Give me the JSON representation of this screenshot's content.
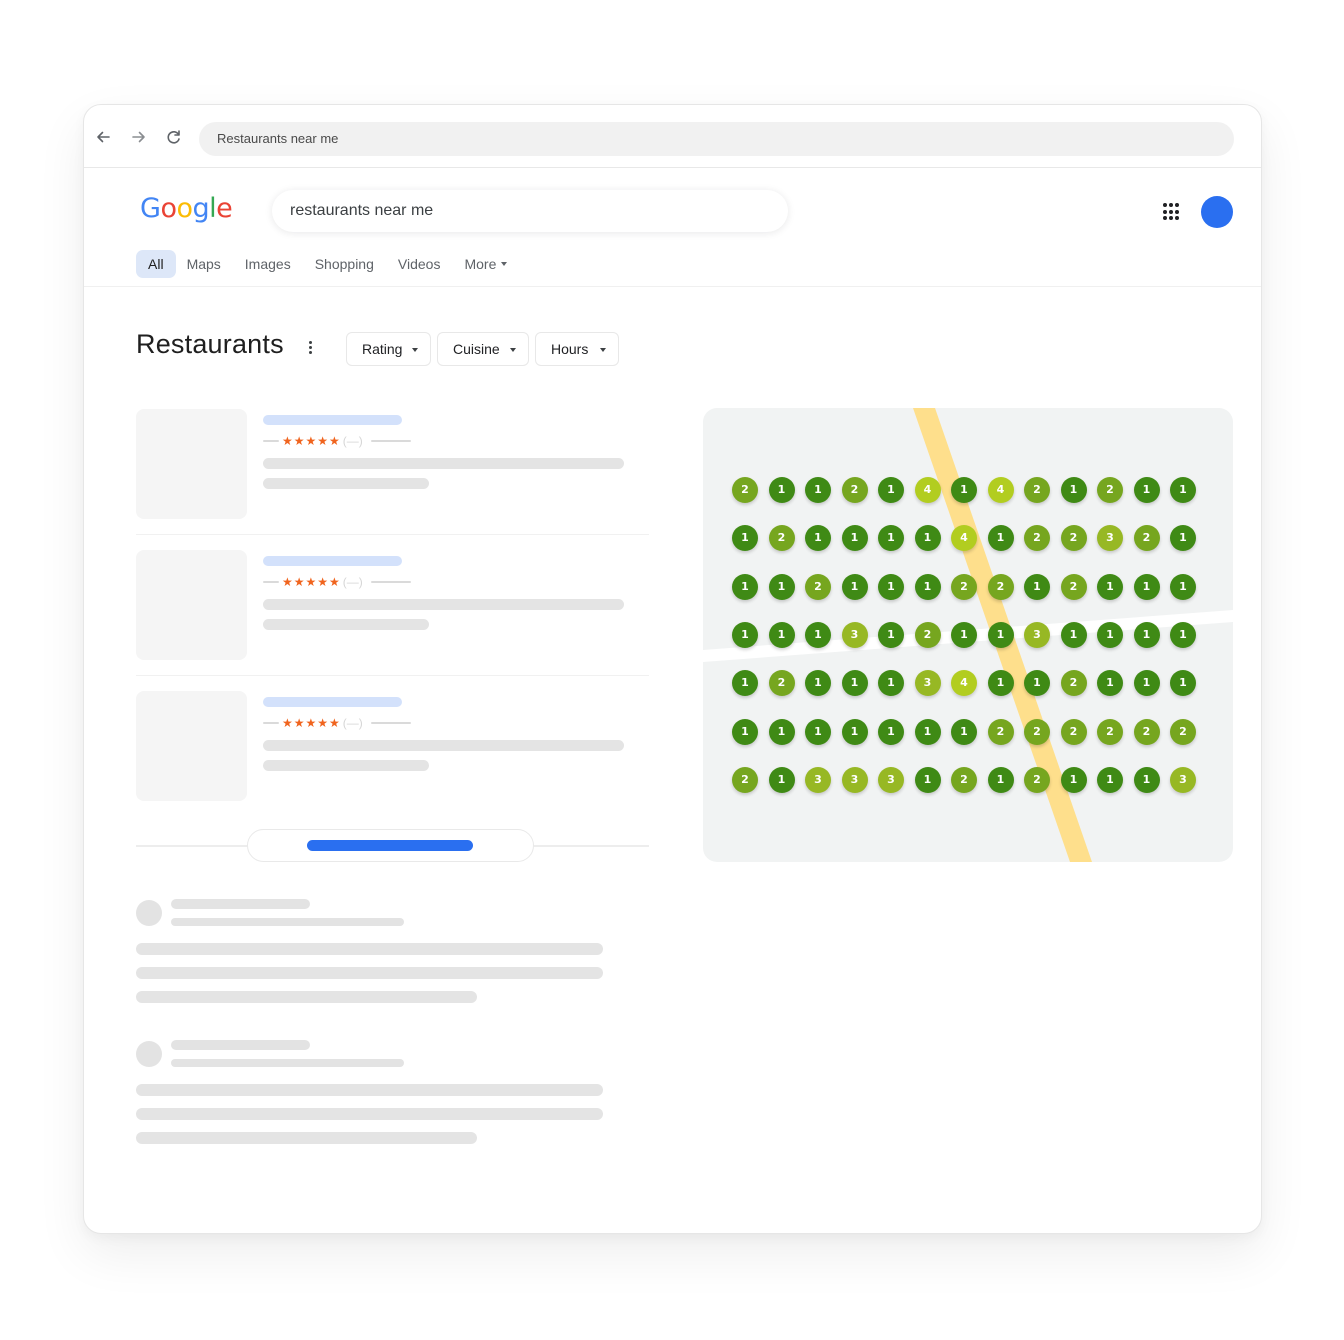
{
  "browser": {
    "address_bar": "Restaurants near me",
    "back_icon": "arrow-left-icon",
    "forward_icon": "arrow-right-icon",
    "reload_icon": "reload-icon"
  },
  "header": {
    "logo": {
      "letters": [
        "G",
        "o",
        "o",
        "g",
        "l",
        "e"
      ],
      "colors": [
        "#4285f4",
        "#ea4335",
        "#fbbc05",
        "#4285f4",
        "#34a853",
        "#ea4335"
      ]
    },
    "search_query": "restaurants near me",
    "apps_icon": "apps-grid-icon",
    "avatar_color": "#2a6ff0"
  },
  "tabs": [
    {
      "label": "All",
      "active": true
    },
    {
      "label": "Maps",
      "active": false
    },
    {
      "label": "Images",
      "active": false
    },
    {
      "label": "Shopping",
      "active": false
    },
    {
      "label": "Videos",
      "active": false
    },
    {
      "label": "More",
      "active": false,
      "dropdown": true
    }
  ],
  "section": {
    "title": "Restaurants",
    "filters": [
      {
        "label": "Rating"
      },
      {
        "label": "Cuisine"
      },
      {
        "label": "Hours"
      }
    ]
  },
  "results": [
    {
      "stars": "★★★★★",
      "reviews": "(—)"
    },
    {
      "stars": "★★★★★",
      "reviews": "(—)"
    },
    {
      "stars": "★★★★★",
      "reviews": "(—)"
    }
  ],
  "colors": {
    "accent": "#2a6ff0",
    "star": "#f0641e",
    "road_main": "#fedf8c",
    "rank_1": "#3f8a15",
    "rank_2": "#76a61f",
    "rank_3": "#97b824",
    "rank_4": "#b2cd20"
  },
  "map": {
    "rank_grid": [
      [
        2,
        1,
        1,
        2,
        1,
        4,
        1,
        4,
        2,
        1,
        2,
        1,
        1
      ],
      [
        1,
        2,
        1,
        1,
        1,
        1,
        4,
        1,
        2,
        2,
        3,
        2,
        1
      ],
      [
        1,
        1,
        2,
        1,
        1,
        1,
        2,
        2,
        1,
        2,
        1,
        1,
        1
      ],
      [
        1,
        1,
        1,
        3,
        1,
        2,
        1,
        1,
        3,
        1,
        1,
        1,
        1
      ],
      [
        1,
        2,
        1,
        1,
        1,
        3,
        4,
        1,
        1,
        2,
        1,
        1,
        1
      ],
      [
        1,
        1,
        1,
        1,
        1,
        1,
        1,
        2,
        2,
        2,
        2,
        2,
        2
      ],
      [
        2,
        1,
        3,
        3,
        3,
        1,
        2,
        1,
        2,
        1,
        1,
        1,
        3
      ]
    ]
  }
}
